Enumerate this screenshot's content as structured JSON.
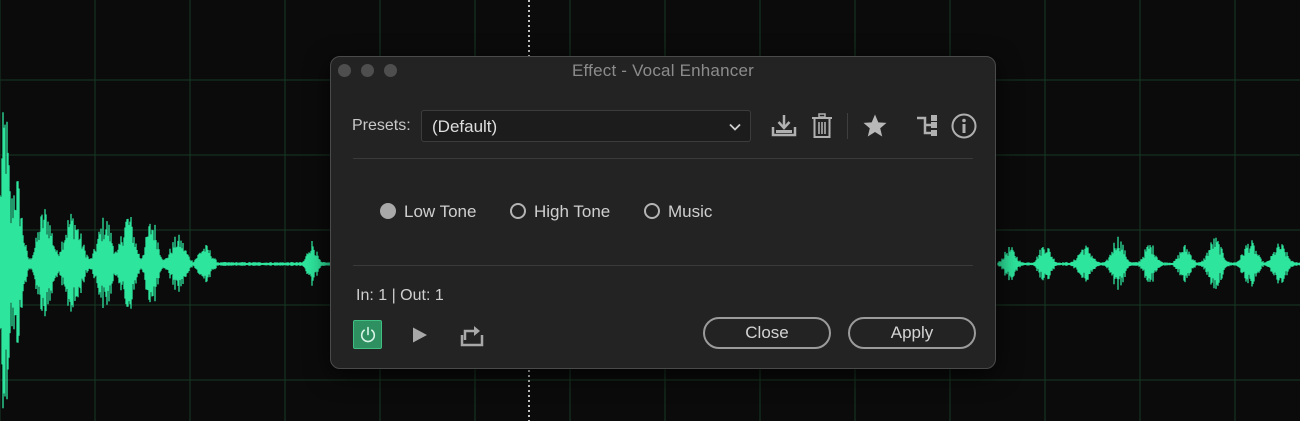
{
  "dialog": {
    "title": "Effect - Vocal Enhancer",
    "presets": {
      "label": "Presets:",
      "selected": "(Default)"
    },
    "toolbar_icons": [
      "save-preset-icon",
      "delete-preset-icon",
      "favorite-star-icon",
      "routing-icon",
      "info-icon"
    ],
    "mode_options": [
      {
        "label": "Low Tone",
        "checked": true
      },
      {
        "label": "High Tone",
        "checked": false
      },
      {
        "label": "Music",
        "checked": false
      }
    ],
    "io_status": "In: 1 | Out: 1",
    "buttons": {
      "close": "Close",
      "apply": "Apply"
    }
  },
  "colors": {
    "waveform": "#2ee59d",
    "power_active": "#2e8f61",
    "background": "#0b0b0b",
    "dialog_bg": "#232323"
  }
}
